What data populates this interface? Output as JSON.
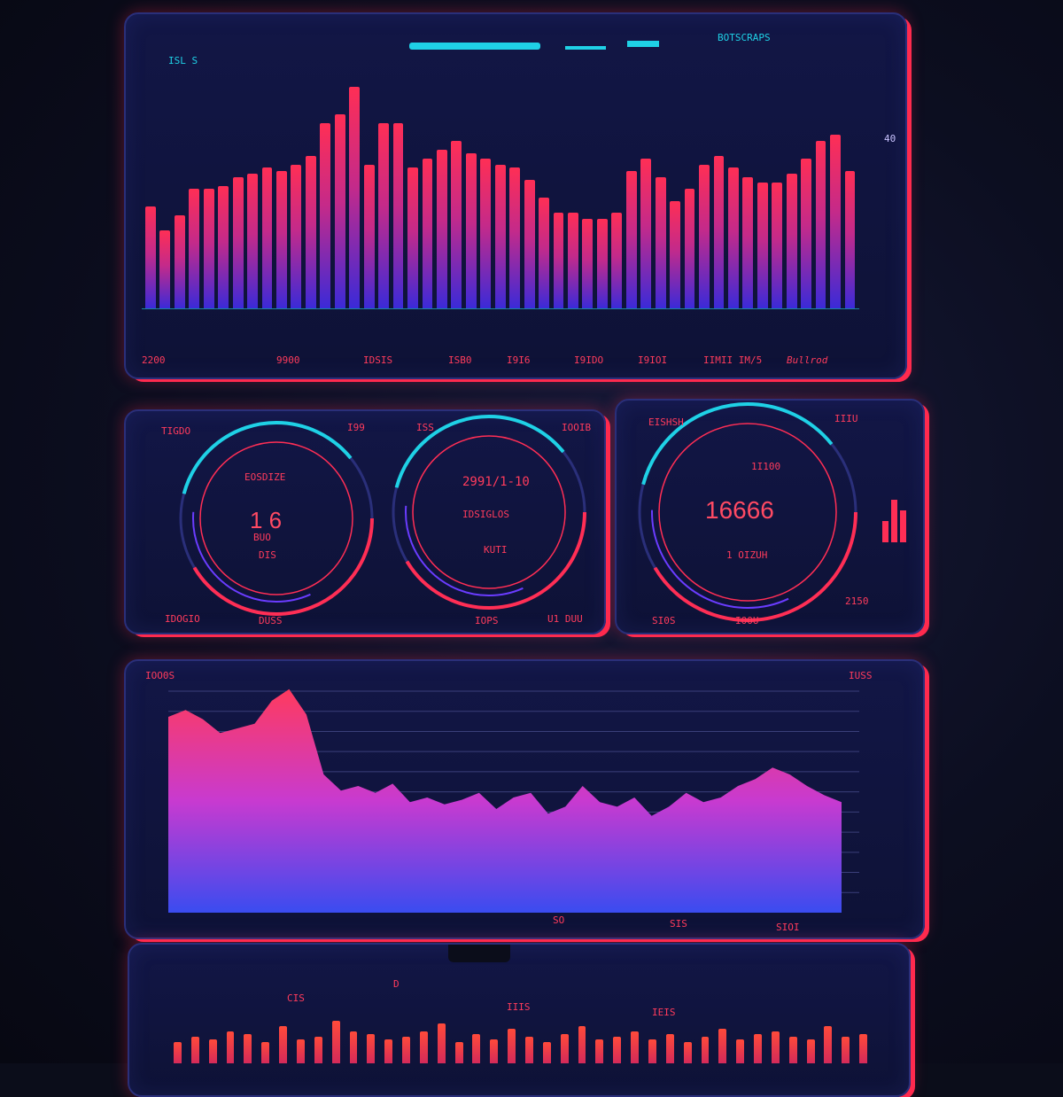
{
  "colors": {
    "accent": "#ff2a4e",
    "cyan": "#1fd1e6",
    "violet": "#6a3cff",
    "panel": "#121646"
  },
  "panel1": {
    "header_labels": [
      "ISL S",
      "BOTSCRAPS"
    ],
    "bottom_labels": [
      "2200",
      "9900",
      "IDSIS",
      "ISB0",
      "I9I6",
      "I9IDO",
      "I9IOI",
      "IIMII IM/5",
      "Bullrod"
    ],
    "right_tick": "40"
  },
  "panel2": {
    "gauge1": {
      "title": "EOSDIZE",
      "value": "1 6",
      "sub": "BUO",
      "foot": "DIS"
    },
    "gauge2": {
      "title": "2991/1-10",
      "sub": "IDSIGLOS",
      "foot": "KUTI"
    },
    "gauge3": {
      "title": "1I100",
      "value": "16666",
      "sub": "1 OIZUH"
    },
    "corner_labels": [
      "TIGDO",
      "I99",
      "ISS",
      "IOOIB",
      "EISHSH",
      "IIIU"
    ],
    "bottom_labels": [
      "IDOGIO",
      "DUSS",
      "IOPS",
      "U1 DUU",
      "SI0S",
      "IOOU",
      "2150"
    ]
  },
  "panel3": {
    "corner_labels": [
      "IOO0S",
      "IUSS"
    ],
    "bottom_labels": [
      "SO",
      "SIS",
      "SIOI"
    ]
  },
  "panel4": {
    "labels": [
      "D",
      "CIS",
      "IIIS",
      "IEIS"
    ]
  },
  "chart_data": [
    {
      "type": "bar",
      "values": [
        34,
        26,
        31,
        40,
        40,
        41,
        44,
        45,
        47,
        46,
        48,
        51,
        62,
        65,
        74,
        48,
        62,
        62,
        47,
        50,
        53,
        56,
        52,
        50,
        48,
        47,
        43,
        37,
        32,
        32,
        30,
        30,
        32,
        46,
        50,
        44,
        36,
        40,
        48,
        51,
        47,
        44,
        42,
        42,
        45,
        50,
        56,
        58,
        46
      ],
      "ylim": [
        0,
        80
      ]
    },
    {
      "type": "gauge",
      "gauges": [
        {
          "value": "1 6"
        },
        {
          "value": "2991/1-10"
        },
        {
          "value": "16666"
        }
      ]
    },
    {
      "type": "area",
      "values": [
        85,
        88,
        84,
        78,
        80,
        82,
        92,
        97,
        86,
        60,
        53,
        55,
        52,
        56,
        48,
        50,
        47,
        49,
        52,
        45,
        50,
        52,
        43,
        46,
        55,
        48,
        46,
        50,
        42,
        46,
        52,
        48,
        50,
        55,
        58,
        63,
        60,
        55,
        51,
        48
      ],
      "ylim": [
        0,
        100
      ]
    },
    {
      "type": "bar",
      "values": [
        40,
        50,
        45,
        60,
        55,
        40,
        70,
        45,
        50,
        80,
        60,
        55,
        45,
        50,
        60,
        75,
        40,
        55,
        45,
        65,
        50,
        40,
        55,
        70,
        45,
        50,
        60,
        45,
        55,
        40,
        50,
        65,
        45,
        55,
        60,
        50,
        45,
        70,
        50,
        55
      ],
      "ylim": [
        0,
        100
      ]
    }
  ]
}
